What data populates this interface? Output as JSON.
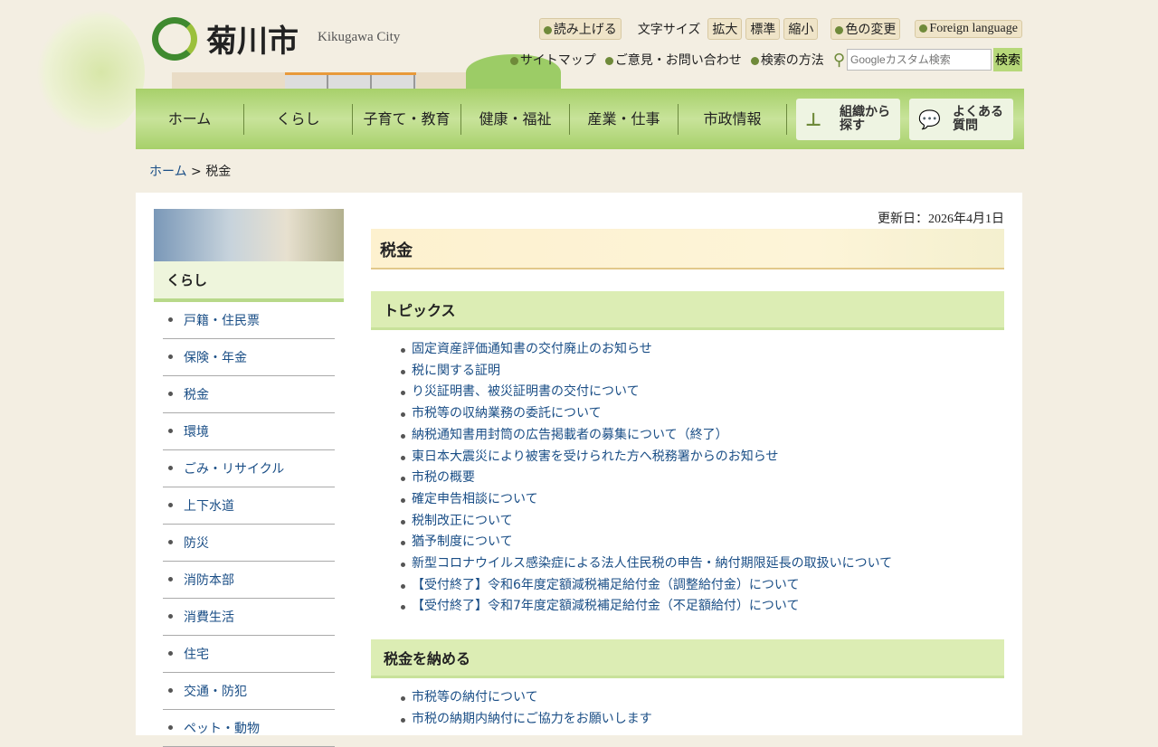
{
  "header": {
    "logo": "菊川市",
    "city_en": "Kikugawa City",
    "util": {
      "read": "読み上げる",
      "font_size_label": "文字サイズ",
      "enlarge": "拡大",
      "standard": "標準",
      "shrink": "縮小",
      "color": "色の変更",
      "foreign": "Foreign language"
    },
    "links": [
      "サイトマップ",
      "ご意見・お問い合わせ",
      "検索の方法"
    ],
    "search_placeholder": "Googleカスタム検索",
    "search_button": "検索"
  },
  "nav": {
    "items": [
      "ホーム",
      "くらし",
      "子育て・教育",
      "健康・福祉",
      "産業・仕事",
      "市政情報"
    ],
    "org": "組織から探す",
    "faq": "よくある質問"
  },
  "breadcrumb": {
    "home": "ホーム",
    "sep": ">",
    "current": "税金"
  },
  "sidebar": {
    "title": "くらし",
    "items": [
      "戸籍・住民票",
      "保険・年金",
      "税金",
      "環境",
      "ごみ・リサイクル",
      "上下水道",
      "防災",
      "消防本部",
      "消費生活",
      "住宅",
      "交通・防犯",
      "ペット・動物"
    ]
  },
  "content": {
    "updated": "更新日：2026年4月1日",
    "title": "税金",
    "sections": [
      {
        "title": "トピックス",
        "items": [
          "固定資産評価通知書の交付廃止のお知らせ",
          "税に関する証明",
          "り災証明書、被災証明書の交付について",
          "市税等の収納業務の委託について",
          "納税通知書用封筒の広告掲載者の募集について（終了）",
          "東日本大震災により被害を受けられた方へ税務署からのお知らせ",
          "市税の概要",
          "確定申告相談について",
          "税制改正について",
          "猶予制度について",
          "新型コロナウイルス感染症による法人住民税の申告・納付期限延長の取扱いについて",
          "【受付終了】令和6年度定額減税補足給付金（調整給付金）について",
          "【受付終了】令和7年度定額減税補足給付金（不足額給付）について"
        ]
      },
      {
        "title": "税金を納める",
        "items": [
          "市税等の納付について",
          "市税の納期内納付にご協力をお願いします"
        ]
      }
    ]
  }
}
